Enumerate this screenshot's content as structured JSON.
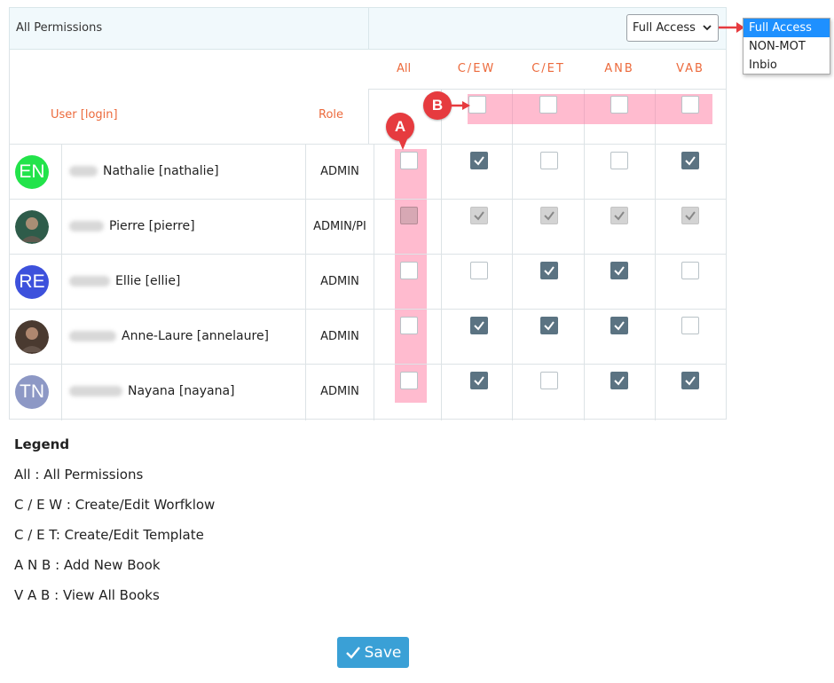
{
  "header": {
    "title": "All Permissions"
  },
  "access_select": {
    "value": "Full Access",
    "options": [
      "Full Access",
      "NON-MOT",
      "Inbio"
    ]
  },
  "table": {
    "col_user": "User [login]",
    "col_role": "Role",
    "perm_columns": [
      "All",
      "C/EW",
      "C/ET",
      "ANB",
      "VAB"
    ],
    "rows": [
      {
        "initials": "EN",
        "avatar_color": "#22e34a",
        "name": "Nathalie [nathalie]",
        "role": "ADMIN",
        "perms": [
          false,
          true,
          false,
          false,
          true
        ],
        "disabled": false
      },
      {
        "initials": "",
        "avatar_color": "#2e5c4a",
        "name": "Pierre [pierre]",
        "role": "ADMIN/PI",
        "perms": [
          false,
          true,
          true,
          true,
          true
        ],
        "disabled": true
      },
      {
        "initials": "RE",
        "avatar_color": "#3d51dc",
        "name": "Ellie [ellie]",
        "role": "ADMIN",
        "perms": [
          false,
          false,
          true,
          true,
          false
        ],
        "disabled": false
      },
      {
        "initials": "",
        "avatar_color": "#4a3a30",
        "name": "Anne-Laure [annelaure]",
        "role": "ADMIN",
        "perms": [
          false,
          true,
          true,
          true,
          false
        ],
        "disabled": false
      },
      {
        "initials": "TN",
        "avatar_color": "#8d98c5",
        "name": "Nayana [nayana]",
        "role": "ADMIN",
        "perms": [
          false,
          true,
          false,
          true,
          true
        ],
        "disabled": false
      }
    ]
  },
  "markers": {
    "a": "A",
    "b": "B"
  },
  "legend": {
    "title": "Legend",
    "items": [
      "All : All Permissions",
      "C / E W : Create/Edit Worfklow",
      "C / E T: Create/Edit Template",
      "A N B : Add New Book",
      "V A B : View All Books"
    ]
  },
  "save_label": "Save",
  "colors": {
    "accent": "#ec6a3c",
    "checked": "#5b7382",
    "save": "#3aa0d6",
    "highlight": "#ff78a0",
    "marker": "#e63b3f"
  }
}
